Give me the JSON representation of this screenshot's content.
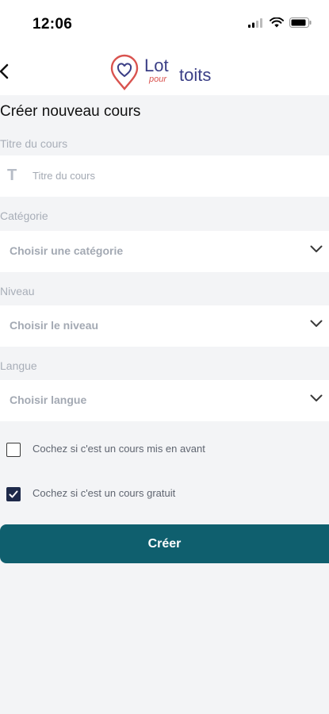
{
  "status": {
    "time": "12:06"
  },
  "header": {
    "logo_lot": "Lot",
    "logo_pour": "pour",
    "logo_toits": "toits"
  },
  "page": {
    "title": "Créer nouveau cours"
  },
  "form": {
    "course_title": {
      "label": "Titre du cours",
      "placeholder": "Titre du cours"
    },
    "category": {
      "label": "Catégorie",
      "value": "Choisir une catégorie"
    },
    "level": {
      "label": "Niveau",
      "value": "Choisir le niveau"
    },
    "language": {
      "label": "Langue",
      "value": "Choisir langue"
    },
    "featured": {
      "label": "Cochez si c'est un cours mis en avant",
      "checked": false
    },
    "free": {
      "label": "Cochez si c'est un cours gratuit",
      "checked": true
    },
    "submit_label": "Créer"
  },
  "colors": {
    "primary_button": "#0f5f6e",
    "logo_text": "#3b3f86",
    "logo_accent": "#d9534f",
    "checkbox_checked": "#1e2a4a"
  }
}
